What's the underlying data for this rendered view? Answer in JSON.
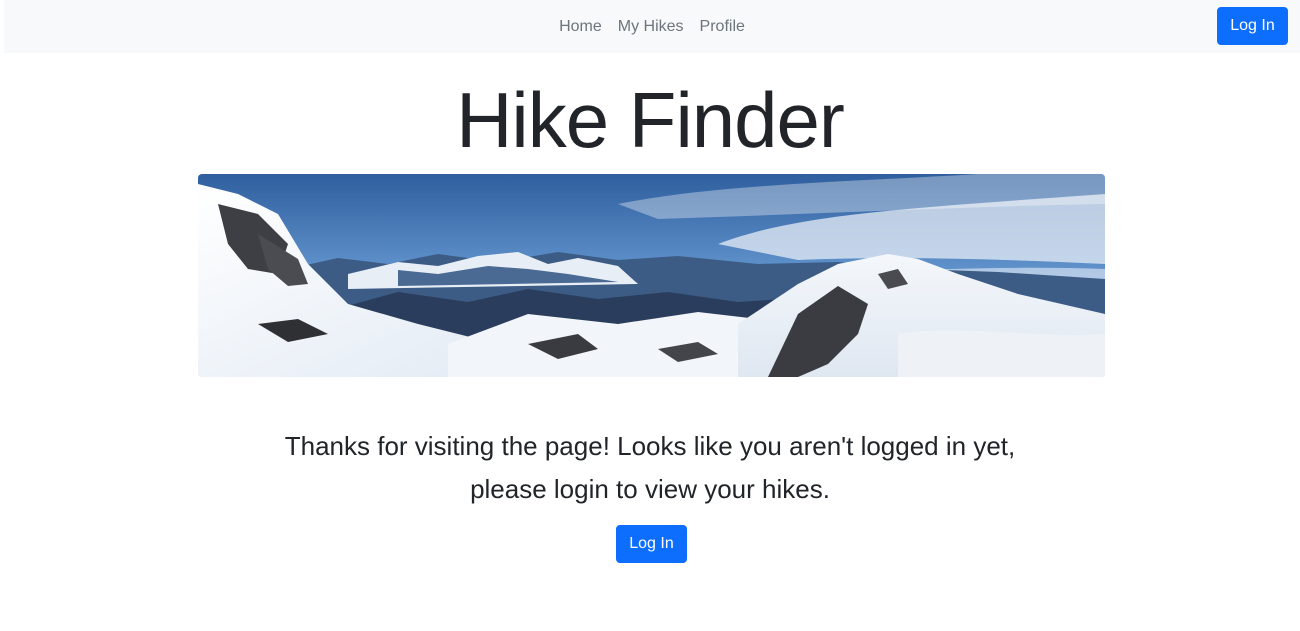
{
  "nav": {
    "links": [
      {
        "label": "Home"
      },
      {
        "label": "My Hikes"
      },
      {
        "label": "Profile"
      }
    ],
    "login_label": "Log In"
  },
  "main": {
    "title": "Hike Finder",
    "hero_image": "snowy-mountain-panorama",
    "message_line1": "Thanks for visiting the page! Looks like you aren't logged in yet,",
    "message_line2": "please login to view your hikes.",
    "login_label": "Log In"
  },
  "colors": {
    "primary": "#0d6efd",
    "navbar_bg": "#f8f9fa",
    "nav_link": "#6c757d",
    "text": "#212529"
  }
}
